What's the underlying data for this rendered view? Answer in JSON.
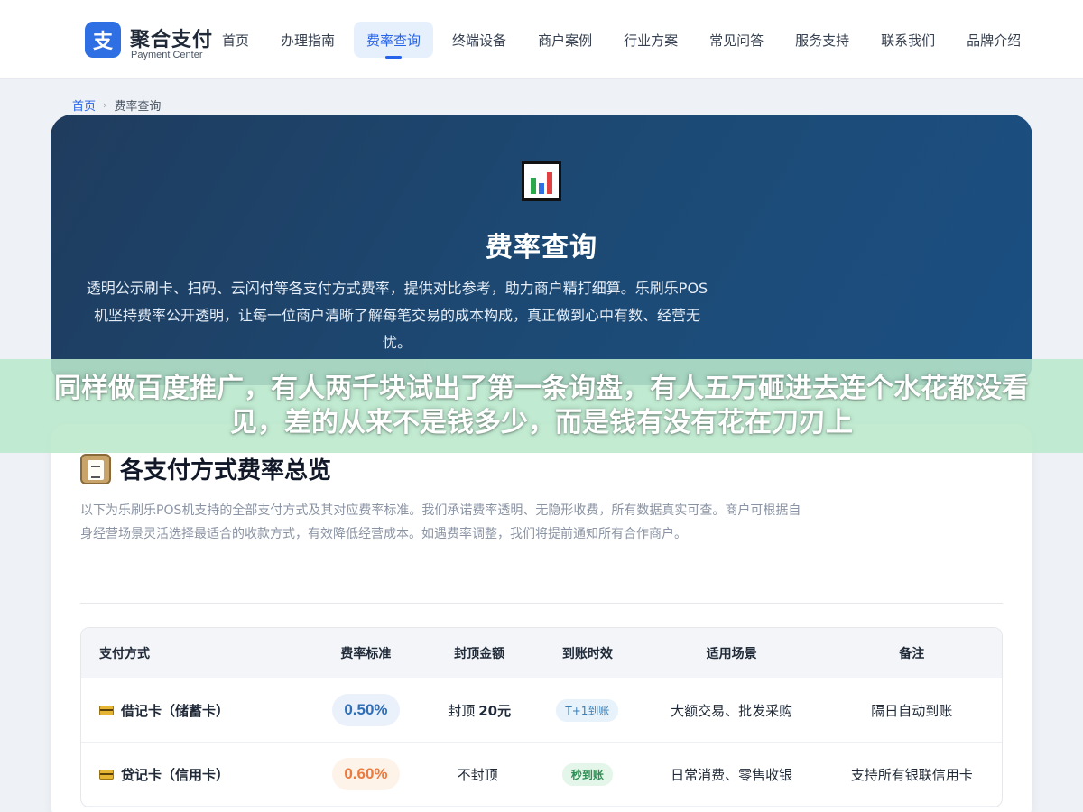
{
  "header": {
    "logo_char": "支",
    "brand_title": "聚合支付",
    "brand_subtitle": "Payment Center",
    "nav": [
      {
        "label": "首页",
        "active": false
      },
      {
        "label": "办理指南",
        "active": false
      },
      {
        "label": "费率查询",
        "active": true
      },
      {
        "label": "终端设备",
        "active": false
      },
      {
        "label": "商户案例",
        "active": false
      },
      {
        "label": "行业方案",
        "active": false
      },
      {
        "label": "常见问答",
        "active": false
      },
      {
        "label": "服务支持",
        "active": false
      },
      {
        "label": "联系我们",
        "active": false
      },
      {
        "label": "品牌介绍",
        "active": false
      }
    ]
  },
  "breadcrumb": {
    "home": "首页",
    "separator": "›",
    "current": "费率查询"
  },
  "hero": {
    "icon": "bar-chart-icon",
    "title": "费率查询",
    "description": "透明公示刷卡、扫码、云闪付等各支付方式费率，提供对比参考，助力商户精打细算。乐刷乐POS机坚持费率公开透明，让每一位商户清晰了解每笔交易的成本构成，真正做到心中有数、经营无忧。"
  },
  "banner": {
    "text": "同样做百度推广，有人两千块试出了第一条询盘，有人五万砸进去连个水花都没看见，差的从来不是钱多少，而是钱有没有花在刀刃上"
  },
  "section": {
    "icon": "clipboard-icon",
    "title": "各支付方式费率总览",
    "description": "以下为乐刷乐POS机支持的全部支付方式及其对应费率标准。我们承诺费率透明、无隐形收费，所有数据真实可查。商户可根据自身经营场景灵活选择最适合的收款方式，有效降低经营成本。如遇费率调整，我们将提前通知所有合作商户。"
  },
  "table": {
    "headers": [
      "支付方式",
      "费率标准",
      "封顶金额",
      "到账时效",
      "适用场景",
      "备注"
    ],
    "rows": [
      {
        "icon": "credit-card-icon",
        "method": "借记卡（储蓄卡）",
        "rate": "0.50%",
        "rate_color": "#2f6fb7",
        "cap_prefix": "封顶",
        "cap_value": "20元",
        "settle": "T+1到账",
        "scenario": "大额交易、批发采购",
        "note": "隔日自动到账"
      },
      {
        "icon": "credit-card-icon",
        "method": "贷记卡（信用卡）",
        "rate": "0.60%",
        "rate_color": "#ea7a3d",
        "cap_prefix": "不封顶",
        "cap_value": "",
        "settle": "秒到账",
        "scenario": "日常消费、零售收银",
        "note": "支持所有银联信用卡"
      }
    ]
  },
  "colors": {
    "accent": "#2563eb",
    "hero_bg": "#1c4a75",
    "banner_bg": "#bae8cc"
  }
}
